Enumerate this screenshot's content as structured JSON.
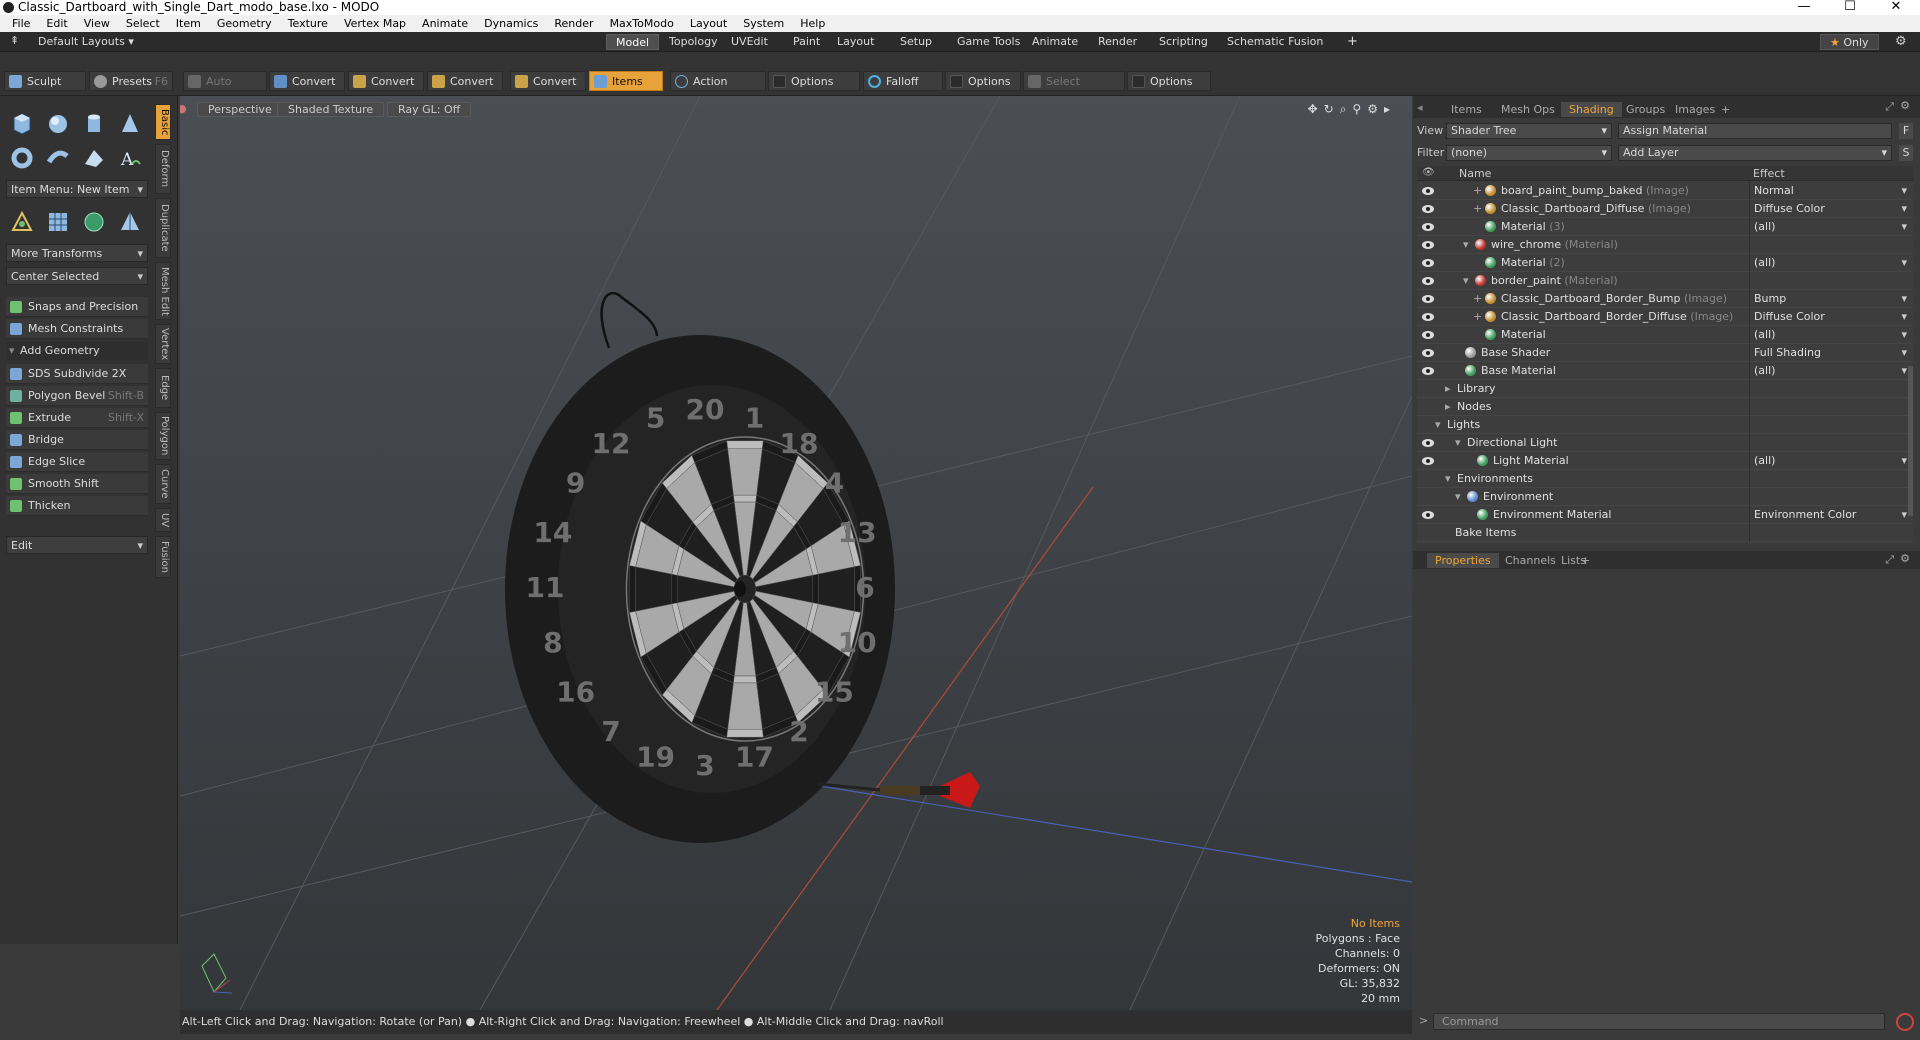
{
  "window": {
    "title": "Classic_Dartboard_with_Single_Dart_modo_base.lxo - MODO",
    "min": "—",
    "max": "☐",
    "close": "✕"
  },
  "menu": [
    "File",
    "Edit",
    "View",
    "Select",
    "Item",
    "Geometry",
    "Texture",
    "Vertex Map",
    "Animate",
    "Dynamics",
    "Render",
    "MaxToModo",
    "Layout",
    "System",
    "Help"
  ],
  "layouts": {
    "dropdown": "Default Layouts",
    "tabs": [
      "Model",
      "Topology",
      "UVEdit",
      "Paint",
      "Layout",
      "Setup",
      "Game Tools",
      "Animate",
      "Render",
      "Scripting",
      "Schematic Fusion"
    ],
    "active": "Model",
    "only": "Only"
  },
  "toolbar": {
    "sculpt": "Sculpt",
    "presets": "Presets",
    "presets_key": "F6",
    "auto_select": "Auto Select",
    "convert": "Convert",
    "items": "Items",
    "action_center": "Action Center",
    "options": "Options",
    "falloff": "Falloff",
    "select_through": "Select Through"
  },
  "left": {
    "side_tabs": [
      "Basic",
      "Deform",
      "Duplicate",
      "Mesh Edit",
      "Vertex",
      "Edge",
      "Polygon",
      "Curve",
      "UV",
      "Fusion"
    ],
    "item_menu": "Item Menu: New Item",
    "more_transforms": "More Transforms",
    "center_selected": "Center Selected",
    "snaps": "Snaps and Precision",
    "mesh_constraints": "Mesh Constraints",
    "add_geometry": "Add Geometry",
    "tools": [
      {
        "label": "SDS Subdivide 2X",
        "key": ""
      },
      {
        "label": "Polygon Bevel",
        "key": "Shift-B"
      },
      {
        "label": "Extrude",
        "key": "Shift-X"
      },
      {
        "label": "Bridge",
        "key": ""
      },
      {
        "label": "Edge Slice",
        "key": ""
      },
      {
        "label": "Smooth Shift",
        "key": ""
      },
      {
        "label": "Thicken",
        "key": ""
      }
    ],
    "edit": "Edit"
  },
  "viewport": {
    "tabs": [
      "Perspective",
      "Shaded Texture",
      "Ray GL: Off"
    ],
    "board_numbers": [
      "20",
      "1",
      "18",
      "4",
      "13",
      "6",
      "10",
      "15",
      "2",
      "17",
      "3",
      "19",
      "7",
      "16",
      "8",
      "11",
      "14",
      "9",
      "12",
      "5"
    ],
    "hud": {
      "items": "No Items",
      "polygons": "Polygons : Face",
      "channels": "Channels: 0",
      "deformers": "Deformers: ON",
      "gl": "GL: 35,832",
      "scale": "20 mm"
    }
  },
  "status": "Alt-Left Click and Drag: Navigation: Rotate (or Pan) ● Alt-Right Click and Drag: Navigation: Freewheel ● Alt-Middle Click and Drag: navRoll",
  "right": {
    "tabs": [
      "Items",
      "Mesh Ops",
      "Shading",
      "Groups",
      "Images"
    ],
    "active_tab": "Shading",
    "view_label": "View",
    "view_value": "Shader Tree",
    "assign": "Assign Material",
    "assign_key": "F",
    "filter_label": "Filter",
    "filter_value": "(none)",
    "add_layer": "Add Layer",
    "add_layer_key": "S",
    "col_name": "Name",
    "col_effect": "Effect",
    "rows": [
      {
        "name": "board_paint_bump_baked",
        "type": "(Image)",
        "effect": "Normal",
        "eye": true,
        "ball": "#c38b2a",
        "dropdown": true
      },
      {
        "name": "Classic_Dartboard_Diffuse",
        "type": "(Image)",
        "effect": "Diffuse Color",
        "eye": true,
        "ball": "#c38b2a",
        "dropdown": true
      },
      {
        "name": "Material",
        "type": "(3)",
        "effect": "(all)",
        "eye": true,
        "ball": "#3f9a5a",
        "dropdown": true
      },
      {
        "name": "wire_chrome",
        "type": "(Material)",
        "effect": "",
        "eye": true,
        "ball": "#c0312b",
        "dropdown": false
      },
      {
        "name": "Material",
        "type": "(2)",
        "effect": "(all)",
        "eye": true,
        "ball": "#3f9a5a",
        "dropdown": true
      },
      {
        "name": "border_paint",
        "type": "(Material)",
        "effect": "",
        "eye": true,
        "ball": "#c0312b",
        "dropdown": false
      },
      {
        "name": "Classic_Dartboard_Border_Bump",
        "type": "(Image)",
        "effect": "Bump",
        "eye": true,
        "ball": "#c38b2a",
        "dropdown": true
      },
      {
        "name": "Classic_Dartboard_Border_Diffuse",
        "type": "(Image)",
        "effect": "Diffuse Color",
        "eye": true,
        "ball": "#c38b2a",
        "dropdown": true
      },
      {
        "name": "Material",
        "type": "",
        "effect": "(all)",
        "eye": true,
        "ball": "#3f9a5a",
        "dropdown": true
      },
      {
        "name": "Base Shader",
        "type": "",
        "effect": "Full Shading",
        "eye": true,
        "ball": "#9a9a9a",
        "dropdown": true
      },
      {
        "name": "Base Material",
        "type": "",
        "effect": "(all)",
        "eye": true,
        "ball": "#3f9a5a",
        "dropdown": true
      },
      {
        "name": "Library",
        "type": "",
        "effect": "",
        "eye": false,
        "ball": "",
        "dropdown": false
      },
      {
        "name": "Nodes",
        "type": "",
        "effect": "",
        "eye": false,
        "ball": "",
        "dropdown": false
      },
      {
        "name": "Lights",
        "type": "",
        "effect": "",
        "eye": false,
        "ball": "",
        "dropdown": false
      },
      {
        "name": "Directional Light",
        "type": "",
        "effect": "",
        "eye": true,
        "ball": "",
        "dropdown": false
      },
      {
        "name": "Light Material",
        "type": "",
        "effect": "(all)",
        "eye": true,
        "ball": "#3f9a5a",
        "dropdown": true
      },
      {
        "name": "Environments",
        "type": "",
        "effect": "",
        "eye": false,
        "ball": "",
        "dropdown": false
      },
      {
        "name": "Environment",
        "type": "",
        "effect": "",
        "eye": false,
        "ball": "#5a88d0",
        "dropdown": false
      },
      {
        "name": "Environment Material",
        "type": "",
        "effect": "Environment Color",
        "eye": true,
        "ball": "#3f9a5a",
        "dropdown": true
      },
      {
        "name": "Bake Items",
        "type": "",
        "effect": "",
        "eye": false,
        "ball": "",
        "dropdown": false
      }
    ],
    "props_tabs": [
      "Properties",
      "Channels",
      "Lists"
    ],
    "props_active": "Properties",
    "command_placeholder": "Command"
  }
}
